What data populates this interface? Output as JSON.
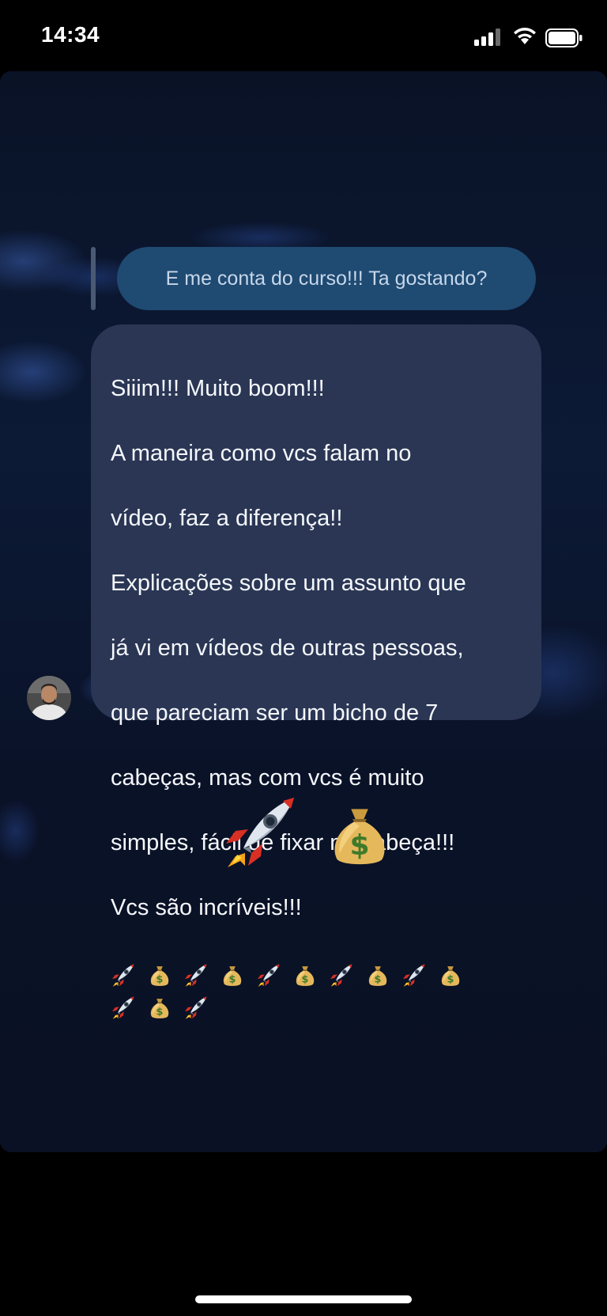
{
  "status_bar": {
    "time": "14:34",
    "icons": [
      "signal-icon",
      "wifi-icon",
      "battery-icon"
    ]
  },
  "conversation": {
    "replied_message": "E me conta do curso!!! Ta gostando?",
    "received_message": {
      "lines": [
        "Siiim!!! Muito boom!!!",
        "A maneira como vcs falam no",
        "vídeo, faz a diferença!!",
        "Explicações sobre um assunto que",
        "já vi em vídeos de outras pessoas,",
        "que pareciam ser um bicho de 7",
        "cabeças, mas com vcs é muito",
        "simples, fácil de fixar na cabeça!!!",
        "Vcs são incríveis!!!"
      ],
      "emoji_sequence": [
        "rocket-emoji",
        "money-bag-emoji",
        "rocket-emoji",
        "money-bag-emoji",
        "rocket-emoji",
        "money-bag-emoji",
        "rocket-emoji",
        "money-bag-emoji",
        "rocket-emoji",
        "money-bag-emoji",
        "rocket-emoji",
        "money-bag-emoji",
        "rocket-emoji"
      ]
    },
    "reaction_emojis": [
      "rocket-emoji",
      "money-bag-emoji"
    ]
  },
  "colors": {
    "background": "#0b1428",
    "sent_bubble": "#1f4a72",
    "received_bubble": "#2a3654"
  }
}
